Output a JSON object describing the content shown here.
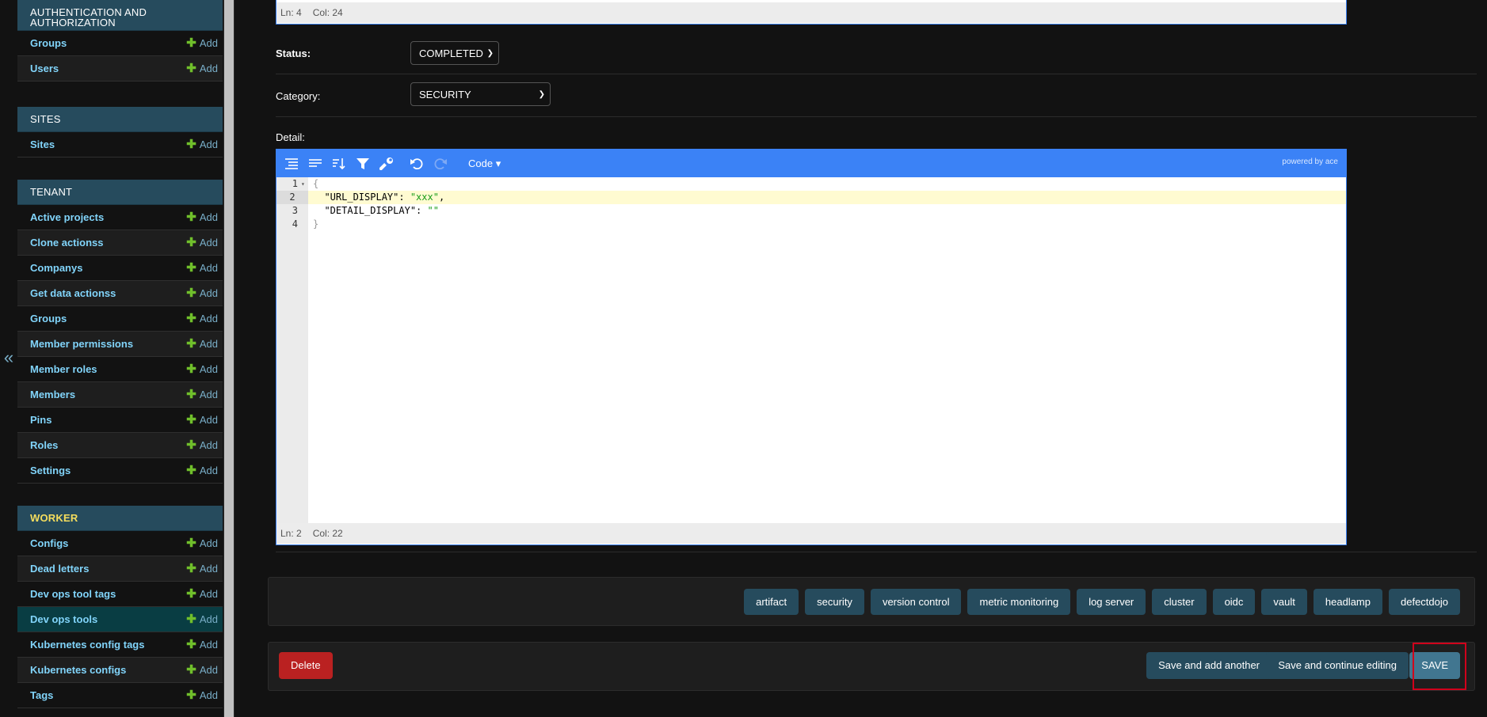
{
  "sidebar": {
    "collapse_glyph": "«",
    "add_label": "Add",
    "modules": [
      {
        "caption": "AUTHENTICATION AND AUTHORIZATION",
        "current": false,
        "items": [
          "Groups",
          "Users"
        ]
      },
      {
        "caption": "SITES",
        "current": false,
        "items": [
          "Sites"
        ]
      },
      {
        "caption": "TENANT",
        "current": false,
        "items": [
          "Active projects",
          "Clone actionss",
          "Companys",
          "Get data actionss",
          "Groups",
          "Member permissions",
          "Member roles",
          "Members",
          "Pins",
          "Roles",
          "Settings"
        ]
      },
      {
        "caption": "WORKER",
        "current": true,
        "items": [
          "Configs",
          "Dead letters",
          "Dev ops tool tags",
          "Dev ops tools",
          "Kubernetes config tags",
          "Kubernetes configs",
          "Tags"
        ],
        "selected_item": "Dev ops tools"
      }
    ]
  },
  "top_editor": {
    "status_ln": "Ln: 4",
    "status_col": "Col: 24"
  },
  "form": {
    "status_label": "Status:",
    "status_value": "COMPLETED",
    "category_label": "Category:",
    "category_value": "SECURITY",
    "detail_label": "Detail:"
  },
  "editor": {
    "mode_label": "Code ▾",
    "powered_by": "powered by ace",
    "icons": [
      "format-icon",
      "compact-icon",
      "sort-icon",
      "filter-icon",
      "repair-icon",
      "undo-icon",
      "redo-icon"
    ],
    "lines": [
      {
        "num": "1",
        "text": "{"
      },
      {
        "num": "2",
        "key": "\"URL_DISPLAY\"",
        "sep": ": ",
        "value": "\"xxx\"",
        "end": ","
      },
      {
        "num": "3",
        "key": "\"DETAIL_DISPLAY\"",
        "sep": ": ",
        "value": "\"\"",
        "end": ""
      },
      {
        "num": "4",
        "text": "}"
      }
    ],
    "status_ln": "Ln: 2",
    "status_col": "Col: 22"
  },
  "tags": [
    "artifact",
    "security",
    "version control",
    "metric monitoring",
    "log server",
    "cluster",
    "oidc",
    "vault",
    "headlamp",
    "defectdojo"
  ],
  "submit": {
    "delete_label": "Delete",
    "save_add_label": "Save and add another",
    "save_continue_label": "Save and continue editing",
    "save_label": "SAVE"
  },
  "colors": {
    "caption_bg": "#264b5d",
    "link": "#81d4fa",
    "add_plus": "#70bf2b",
    "ace_toolbar": "#3b82f6",
    "delete": "#ba2121",
    "highlight": "#d0021b"
  }
}
